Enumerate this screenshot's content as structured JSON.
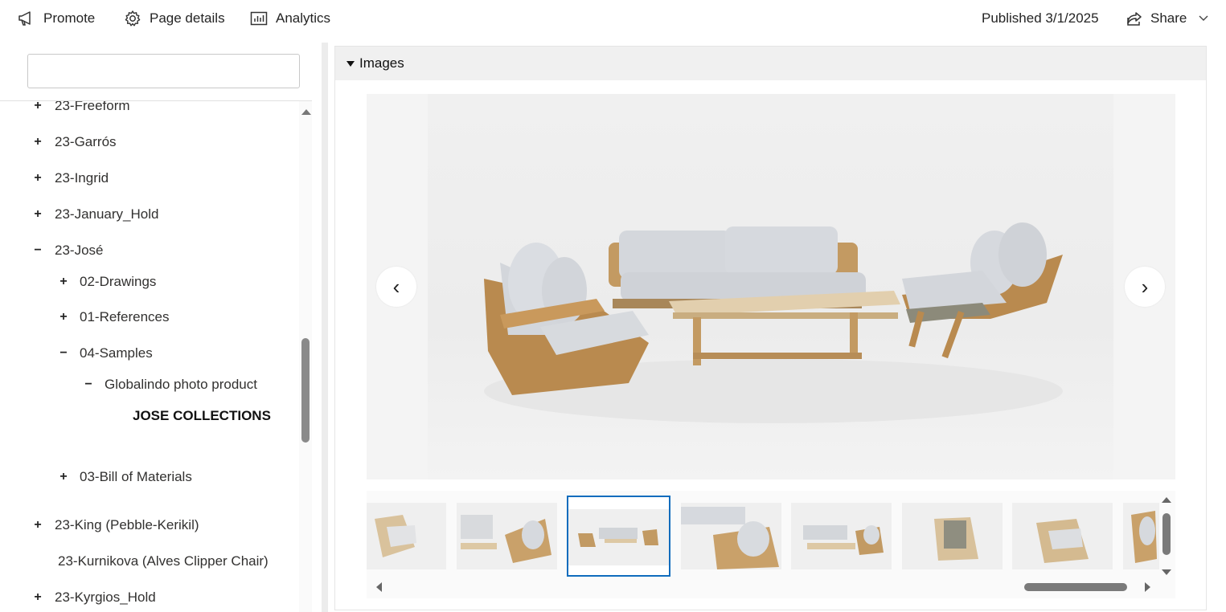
{
  "toolbar": {
    "promote_label": "Promote",
    "page_details_label": "Page details",
    "analytics_label": "Analytics",
    "published_status": "Published 3/1/2025",
    "share_label": "Share"
  },
  "sidebar": {
    "search": {
      "value": "",
      "placeholder": ""
    },
    "tree": [
      {
        "label": "23-Freeform",
        "toggle": "+"
      },
      {
        "label": "23-Garrós",
        "toggle": "+"
      },
      {
        "label": "23-Ingrid",
        "toggle": "+"
      },
      {
        "label": "23-January_Hold",
        "toggle": "+"
      },
      {
        "label": "23-José",
        "toggle": "−"
      },
      {
        "label": "02-Drawings",
        "toggle": "+"
      },
      {
        "label": "01-References",
        "toggle": "+"
      },
      {
        "label": "04-Samples",
        "toggle": "−"
      },
      {
        "label": "Globalindo photo product",
        "toggle": "−"
      },
      {
        "label": "JOSE COLLECTIONS",
        "toggle": ""
      },
      {
        "label": "03-Bill of Materials",
        "toggle": "+"
      },
      {
        "label": "23-King (Pebble-Kerikil)",
        "toggle": "+"
      },
      {
        "label": "23-Kurnikova (Alves Clipper Chair)",
        "toggle": ""
      },
      {
        "label": "23-Kyrgios_Hold",
        "toggle": "+"
      }
    ]
  },
  "images_section": {
    "title": "Images",
    "prev_glyph": "‹",
    "next_glyph": "›",
    "thumbnail_count": 8,
    "selected_thumbnail": 3
  },
  "colors": {
    "accent": "#0f6cbd",
    "teak": "#c39a62",
    "cushion": "#d4d7dc",
    "background": "#f0f0f0"
  }
}
